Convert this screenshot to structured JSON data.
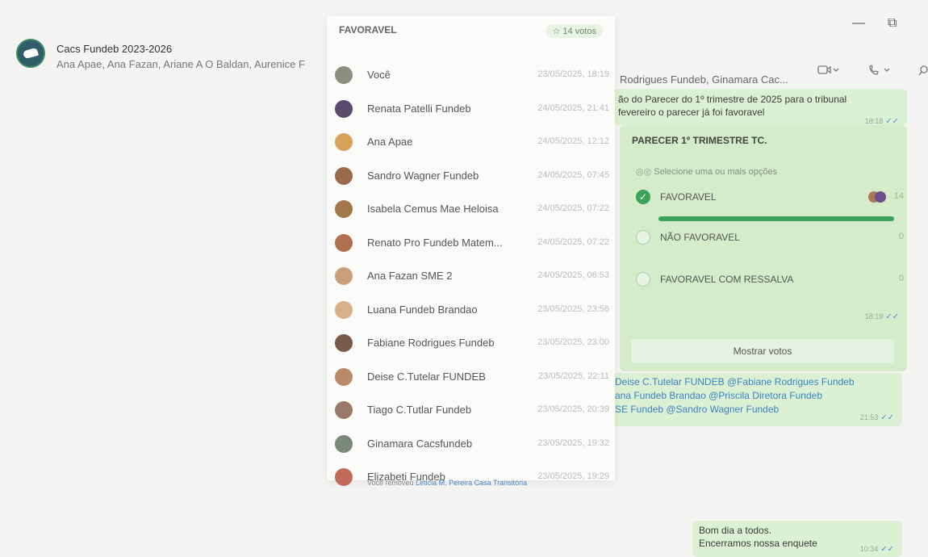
{
  "header": {
    "group_name": "Cacs Fundeb 2023-2026",
    "members_left": "Ana Apae, Ana Fazan, Ariane A O Baldan, Aurenice F",
    "members_right": "Rodrigues Fundeb, Ginamara Cac...",
    "video_icon": "video-icon",
    "call_icon": "phone-icon",
    "search_icon": "search-icon"
  },
  "popup": {
    "option_label": "FAVORAVEL",
    "votes_label": "☆ 14 votos",
    "voters": [
      {
        "name": "Você",
        "time": "23/05/2025, 18:19",
        "color": "#8e8e7e"
      },
      {
        "name": "Renata Patelli Fundeb",
        "time": "24/05/2025, 21:41",
        "color": "#5a4a6e"
      },
      {
        "name": "Ana Apae",
        "time": "24/05/2025, 12:12",
        "color": "#d8a25a"
      },
      {
        "name": "Sandro Wagner Fundeb",
        "time": "24/05/2025, 07:45",
        "color": "#9b6a4a"
      },
      {
        "name": "Isabela Cemus Mae Heloisa",
        "time": "24/05/2025, 07:22",
        "color": "#a0784a"
      },
      {
        "name": "Renato Pro Fundeb Matem...",
        "time": "24/05/2025, 07:22",
        "color": "#b07050"
      },
      {
        "name": "Ana Fazan SME 2",
        "time": "24/05/2025, 06:53",
        "color": "#c9a07a"
      },
      {
        "name": "Luana Fundeb Brandao",
        "time": "23/05/2025, 23:56",
        "color": "#d8b08a"
      },
      {
        "name": "Fabiane Rodrigues Fundeb",
        "time": "23/05/2025, 23:00",
        "color": "#7a5a4a"
      },
      {
        "name": "Deise C.Tutelar FUNDEB",
        "time": "23/05/2025, 22:11",
        "color": "#b88a6a"
      },
      {
        "name": "Tiago C.Tutlar Fundeb",
        "time": "23/05/2025, 20:39",
        "color": "#9a7a6a"
      },
      {
        "name": "Ginamara Cacsfundeb",
        "time": "23/05/2025, 19:32",
        "color": "#7a8a7a"
      },
      {
        "name": "Elizabeti Fundeb",
        "time": "23/05/2025, 19:29",
        "color": "#c06a5a"
      }
    ]
  },
  "chat": {
    "msg1_line1": "ão do Parecer do 1º trimestre de 2025 para o tribunal",
    "msg1_line2": "fevereiro o parecer já foi favoravel",
    "msg1_time": "18:18",
    "poll": {
      "title": "PARECER 1º TRIMESTRE TC.",
      "hint": "Selecione uma ou mais opções",
      "options": [
        {
          "label": "FAVORAVEL",
          "count": "14",
          "checked": true,
          "fraction": 1.0
        },
        {
          "label": "NÃO FAVORAVEL",
          "count": "0",
          "checked": false
        },
        {
          "label": "FAVORAVEL COM RESSALVA",
          "count": "0",
          "checked": false
        }
      ],
      "time": "18:19",
      "show_votes": "Mostrar votos"
    },
    "mention_lines": [
      "Deise C.Tutelar FUNDEB @Fabiane Rodrigues Fundeb",
      "ana Fundeb Brandao @Priscila Diretora Fundeb",
      "SE Fundeb @Sandro Wagner Fundeb"
    ],
    "mention_time": "21:53",
    "removed_prefix": "Você removeu",
    "removed_name": "Leticia M. Pereira Casa Transitória",
    "good_morning_1": "Bom dia a todos.",
    "good_morning_2": "Encerramos nossa enquete",
    "good_morning_time": "10:34"
  }
}
